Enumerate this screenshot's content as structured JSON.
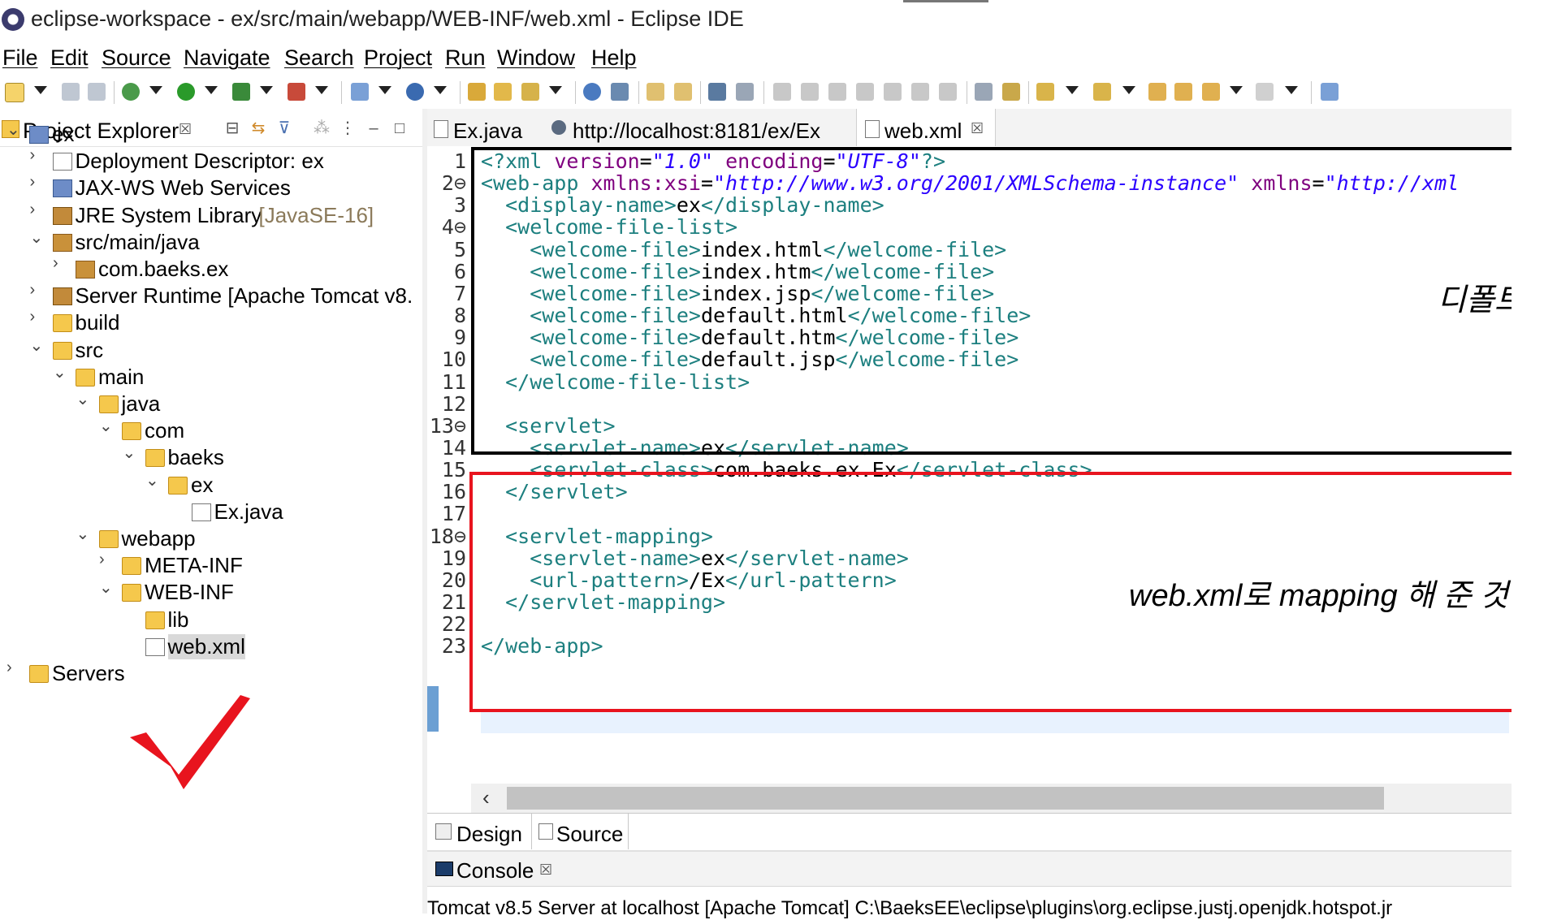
{
  "window": {
    "title": "eclipse-workspace - ex/src/main/webapp/WEB-INF/web.xml - Eclipse IDE"
  },
  "menu": [
    "File",
    "Edit",
    "Source",
    "Navigate",
    "Search",
    "Project",
    "Run",
    "Window",
    "Help"
  ],
  "explorer": {
    "title": "Project Explorer",
    "close": "☒",
    "tree": [
      {
        "label": "ex",
        "chev": "⌄",
        "icon": "proj"
      },
      {
        "label": "Deployment Descriptor: ex",
        "chev": "›",
        "icon": "file"
      },
      {
        "label": "JAX-WS Web Services",
        "chev": "›",
        "icon": "proj"
      },
      {
        "label": "JRE System Library ",
        "suffix": "[JavaSE-16]",
        "chev": "›",
        "icon": "lib"
      },
      {
        "label": "src/main/java",
        "chev": "⌄",
        "icon": "pkg"
      },
      {
        "label": "com.baeks.ex",
        "chev": "›",
        "icon": "pkg"
      },
      {
        "label": "Server Runtime [Apache Tomcat v8.",
        "chev": "›",
        "icon": "lib"
      },
      {
        "label": "build",
        "chev": "›",
        "icon": "folder"
      },
      {
        "label": "src",
        "chev": "⌄",
        "icon": "folder"
      },
      {
        "label": "main",
        "chev": "⌄",
        "icon": "folder"
      },
      {
        "label": "java",
        "chev": "⌄",
        "icon": "folder"
      },
      {
        "label": "com",
        "chev": "⌄",
        "icon": "folder"
      },
      {
        "label": "baeks",
        "chev": "⌄",
        "icon": "folder"
      },
      {
        "label": "ex",
        "chev": "⌄",
        "icon": "folder"
      },
      {
        "label": "Ex.java",
        "chev": "",
        "icon": "file"
      },
      {
        "label": "webapp",
        "chev": "⌄",
        "icon": "folder"
      },
      {
        "label": "META-INF",
        "chev": "›",
        "icon": "folder"
      },
      {
        "label": "WEB-INF",
        "chev": "⌄",
        "icon": "folder"
      },
      {
        "label": "lib",
        "chev": "",
        "icon": "folder"
      },
      {
        "label": "web.xml",
        "chev": "",
        "icon": "file"
      },
      {
        "label": "Servers",
        "chev": "›",
        "icon": "folder"
      }
    ]
  },
  "editor_tabs": [
    {
      "label": "Ex.java"
    },
    {
      "label": "http://localhost:8181/ex/Ex"
    },
    {
      "label": "web.xml",
      "close": "☒"
    }
  ],
  "code_lines": [
    {
      "n": "1",
      "seg": [
        [
          "pi",
          "<?xml "
        ],
        [
          "attr",
          "version"
        ],
        [
          "txt",
          "="
        ],
        [
          "str",
          "\"1.0\""
        ],
        [
          "txt",
          " "
        ],
        [
          "attr",
          "encoding"
        ],
        [
          "txt",
          "="
        ],
        [
          "str",
          "\"UTF-8\""
        ],
        [
          "pi",
          "?>"
        ]
      ]
    },
    {
      "n": "2⊖",
      "seg": [
        [
          "tag",
          "<web-app "
        ],
        [
          "attr",
          "xmlns:xsi"
        ],
        [
          "txt",
          "="
        ],
        [
          "str",
          "\"http://www.w3.org/2001/XMLSchema-instance\""
        ],
        [
          "txt",
          " "
        ],
        [
          "attr",
          "xmlns"
        ],
        [
          "txt",
          "="
        ],
        [
          "str",
          "\"http://xml"
        ]
      ]
    },
    {
      "n": "3",
      "seg": [
        [
          "txt",
          "  "
        ],
        [
          "tag",
          "<display-name>"
        ],
        [
          "txt",
          "ex"
        ],
        [
          "tag",
          "</display-name>"
        ]
      ]
    },
    {
      "n": "4⊖",
      "seg": [
        [
          "txt",
          "  "
        ],
        [
          "tag",
          "<welcome-file-list>"
        ]
      ]
    },
    {
      "n": "5",
      "seg": [
        [
          "txt",
          "    "
        ],
        [
          "tag",
          "<welcome-file>"
        ],
        [
          "txt",
          "index.html"
        ],
        [
          "tag",
          "</welcome-file>"
        ]
      ]
    },
    {
      "n": "6",
      "seg": [
        [
          "txt",
          "    "
        ],
        [
          "tag",
          "<welcome-file>"
        ],
        [
          "txt",
          "index.htm"
        ],
        [
          "tag",
          "</welcome-file>"
        ]
      ]
    },
    {
      "n": "7",
      "seg": [
        [
          "txt",
          "    "
        ],
        [
          "tag",
          "<welcome-file>"
        ],
        [
          "txt",
          "index.jsp"
        ],
        [
          "tag",
          "</welcome-file>"
        ]
      ]
    },
    {
      "n": "8",
      "seg": [
        [
          "txt",
          "    "
        ],
        [
          "tag",
          "<welcome-file>"
        ],
        [
          "txt",
          "default.html"
        ],
        [
          "tag",
          "</welcome-file>"
        ]
      ]
    },
    {
      "n": "9",
      "seg": [
        [
          "txt",
          "    "
        ],
        [
          "tag",
          "<welcome-file>"
        ],
        [
          "txt",
          "default.htm"
        ],
        [
          "tag",
          "</welcome-file>"
        ]
      ]
    },
    {
      "n": "10",
      "seg": [
        [
          "txt",
          "    "
        ],
        [
          "tag",
          "<welcome-file>"
        ],
        [
          "txt",
          "default.jsp"
        ],
        [
          "tag",
          "</welcome-file>"
        ]
      ]
    },
    {
      "n": "11",
      "seg": [
        [
          "txt",
          "  "
        ],
        [
          "tag",
          "</welcome-file-list>"
        ]
      ]
    },
    {
      "n": "12",
      "seg": []
    },
    {
      "n": "13⊖",
      "seg": [
        [
          "txt",
          "  "
        ],
        [
          "tag",
          "<servlet>"
        ]
      ]
    },
    {
      "n": "14",
      "seg": [
        [
          "txt",
          "    "
        ],
        [
          "tag",
          "<servlet-name>"
        ],
        [
          "txt",
          "ex"
        ],
        [
          "tag",
          "</servlet-name>"
        ]
      ]
    },
    {
      "n": "15",
      "seg": [
        [
          "txt",
          "    "
        ],
        [
          "tag",
          "<servlet-class>"
        ],
        [
          "txt",
          "com.baeks.ex.Ex"
        ],
        [
          "tag",
          "</servlet-class>"
        ]
      ]
    },
    {
      "n": "16",
      "seg": [
        [
          "txt",
          "  "
        ],
        [
          "tag",
          "</servlet>"
        ]
      ]
    },
    {
      "n": "17",
      "seg": []
    },
    {
      "n": "18⊖",
      "seg": [
        [
          "txt",
          "  "
        ],
        [
          "tag",
          "<servlet-mapping>"
        ]
      ]
    },
    {
      "n": "19",
      "seg": [
        [
          "txt",
          "    "
        ],
        [
          "tag",
          "<servlet-name>"
        ],
        [
          "txt",
          "ex"
        ],
        [
          "tag",
          "</servlet-name>"
        ]
      ]
    },
    {
      "n": "20",
      "seg": [
        [
          "txt",
          "    "
        ],
        [
          "tag",
          "<url-pattern>"
        ],
        [
          "txt",
          "/Ex"
        ],
        [
          "tag",
          "</url-pattern>"
        ]
      ]
    },
    {
      "n": "21",
      "seg": [
        [
          "txt",
          "  "
        ],
        [
          "tag",
          "</servlet-mapping>"
        ]
      ]
    },
    {
      "n": "22",
      "seg": []
    },
    {
      "n": "23",
      "seg": [
        [
          "tag",
          "</web-app>"
        ]
      ]
    }
  ],
  "annotations": {
    "default_note": "디폴트",
    "mapping_note": "web.xml로 mapping 해 준 것"
  },
  "bottom_tabs": {
    "design": "Design",
    "source": "Source"
  },
  "console": {
    "title": "Console",
    "close": "☒",
    "status": "Tomcat v8.5 Server at localhost [Apache Tomcat] C:\\BaeksEE\\eclipse\\plugins\\org.eclipse.justj.openjdk.hotspot.jr"
  },
  "colors": {
    "highlight_box_red": "#e8141e",
    "highlight_box_black": "#000000",
    "check_red": "#e8141e"
  }
}
